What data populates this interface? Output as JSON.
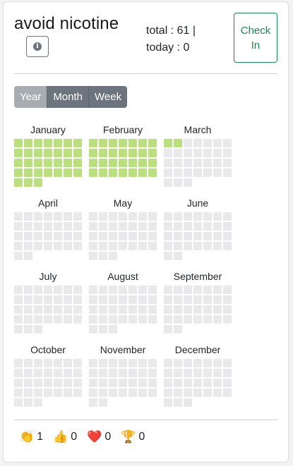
{
  "habit": {
    "title": "avoid nicotine",
    "total_text": "total : 61 |",
    "today_text": "today : 0",
    "checkin_label": "Check In"
  },
  "view_selector": {
    "options": [
      "Year",
      "Month",
      "Week"
    ],
    "active": "Year"
  },
  "calendar": {
    "months": [
      {
        "name": "January",
        "days": 31,
        "done": 31
      },
      {
        "name": "February",
        "days": 28,
        "done": 28
      },
      {
        "name": "March",
        "days": 31,
        "done": 2
      },
      {
        "name": "April",
        "days": 30,
        "done": 0
      },
      {
        "name": "May",
        "days": 31,
        "done": 0
      },
      {
        "name": "June",
        "days": 30,
        "done": 0
      },
      {
        "name": "July",
        "days": 31,
        "done": 0
      },
      {
        "name": "August",
        "days": 31,
        "done": 0
      },
      {
        "name": "September",
        "days": 30,
        "done": 0
      },
      {
        "name": "October",
        "days": 31,
        "done": 0
      },
      {
        "name": "November",
        "days": 30,
        "done": 0
      },
      {
        "name": "December",
        "days": 31,
        "done": 0
      }
    ]
  },
  "reactions": [
    {
      "icon": "clap-icon",
      "emoji": "👏",
      "count": "1"
    },
    {
      "icon": "thumbs-up-icon",
      "emoji": "👍",
      "count": "0"
    },
    {
      "icon": "heart-icon",
      "emoji": "❤️",
      "count": "0"
    },
    {
      "icon": "trophy-icon",
      "emoji": "🏆",
      "count": "0"
    }
  ],
  "colors": {
    "done": "#b9e07d",
    "empty": "#e9e9eb",
    "checkin": "#198754",
    "segment": "#6c757d"
  }
}
